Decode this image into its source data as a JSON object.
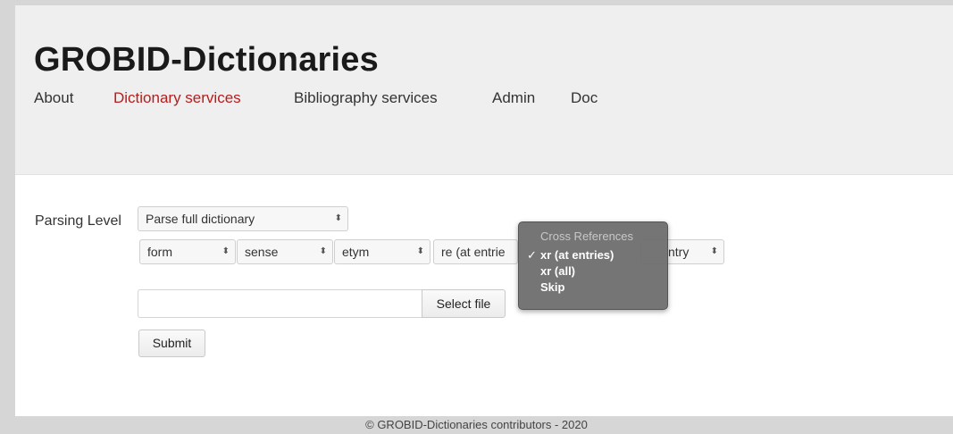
{
  "header": {
    "brand": "GROBID-Dictionaries",
    "nav": {
      "about": "About",
      "dictionary_services": "Dictionary services",
      "bibliography_services": "Bibliography services",
      "admin": "Admin",
      "doc": "Doc"
    },
    "active_color": "#b51d1d"
  },
  "form": {
    "parsing_level_label": "Parsing Level",
    "parsing_level_value": "Parse full dictionary",
    "selects": {
      "form": "form",
      "sense": "sense",
      "etym": "etym",
      "re": "re (at entrie",
      "entry": "ntry"
    },
    "select_file_label": "Select file",
    "submit_label": "Submit",
    "arrow_glyph": "⬍"
  },
  "dropdown": {
    "header": "Cross References",
    "options": [
      "xr (at entries)",
      "xr (all)",
      "Skip"
    ],
    "check": "✓"
  },
  "footer": {
    "text": "© GROBID-Dictionaries contributors - 2020"
  }
}
